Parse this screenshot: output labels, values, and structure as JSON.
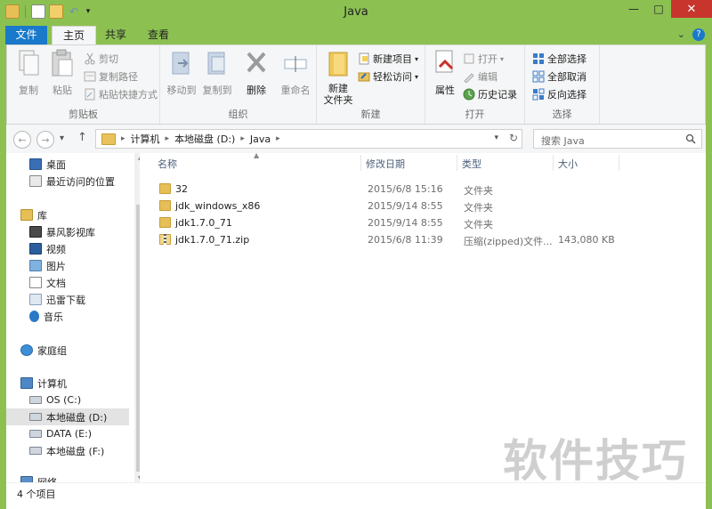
{
  "window": {
    "title": "Java",
    "controls": {
      "minimize": "—",
      "maximize": "□",
      "close": "✕"
    }
  },
  "quick_access": {
    "icons": [
      "folder-icon",
      "properties-icon",
      "new-folder-icon",
      "undo-icon",
      "dropdown-icon"
    ]
  },
  "ribbon_tabs": [
    "文件",
    "主页",
    "共享",
    "查看"
  ],
  "ribbon": {
    "clipboard": {
      "label": "剪贴板",
      "copy": "复制",
      "paste": "粘贴",
      "cut": "剪切",
      "copy_path": "复制路径",
      "paste_shortcut": "粘贴快捷方式"
    },
    "organize": {
      "label": "组织",
      "move_to": "移动到",
      "copy_to": "复制到",
      "delete": "删除",
      "rename": "重命名"
    },
    "new": {
      "label": "新建",
      "new_folder": "新建\n文件夹",
      "new_item": "新建项目",
      "easy_access": "轻松访问"
    },
    "open": {
      "label": "打开",
      "properties": "属性",
      "open": "打开",
      "edit": "编辑",
      "history": "历史记录"
    },
    "select": {
      "label": "选择",
      "select_all": "全部选择",
      "select_none": "全部取消",
      "invert": "反向选择"
    }
  },
  "address_bar": {
    "crumbs": [
      "计算机",
      "本地磁盘 (D:)",
      "Java"
    ],
    "search_placeholder": "搜索 Java"
  },
  "nav_pane": {
    "items": [
      {
        "label": "桌面",
        "icon": "desktop-icon"
      },
      {
        "label": "最近访问的位置",
        "icon": "recent-places-icon"
      },
      {
        "label": "库",
        "icon": "library-icon"
      },
      {
        "label": "暴风影视库",
        "icon": "video-library-icon"
      },
      {
        "label": "视频",
        "icon": "videos-icon"
      },
      {
        "label": "图片",
        "icon": "pictures-icon"
      },
      {
        "label": "文档",
        "icon": "documents-icon"
      },
      {
        "label": "迅雷下载",
        "icon": "downloads-icon"
      },
      {
        "label": "音乐",
        "icon": "music-icon"
      },
      {
        "label": "家庭组",
        "icon": "homegroup-icon"
      },
      {
        "label": "计算机",
        "icon": "computer-icon"
      },
      {
        "label": "OS (C:)",
        "icon": "drive-icon"
      },
      {
        "label": "本地磁盘 (D:)",
        "icon": "drive-icon"
      },
      {
        "label": "DATA (E:)",
        "icon": "drive-icon"
      },
      {
        "label": "本地磁盘 (F:)",
        "icon": "drive-icon"
      },
      {
        "label": "网络",
        "icon": "network-icon"
      }
    ]
  },
  "file_list": {
    "columns": [
      "名称",
      "修改日期",
      "类型",
      "大小"
    ],
    "rows": [
      {
        "name": "32",
        "date": "2015/6/8 15:16",
        "type": "文件夹",
        "size": ""
      },
      {
        "name": "jdk_windows_x86",
        "date": "2015/9/14 8:55",
        "type": "文件夹",
        "size": ""
      },
      {
        "name": "jdk1.7.0_71",
        "date": "2015/9/14 8:55",
        "type": "文件夹",
        "size": ""
      },
      {
        "name": "jdk1.7.0_71.zip",
        "date": "2015/6/8 11:39",
        "type": "压缩(zipped)文件...",
        "size": "143,080 KB"
      }
    ]
  },
  "status": {
    "item_count": "4 个项目"
  },
  "watermark": "软件技巧",
  "colors": {
    "frame": "#8cc152",
    "file_tab": "#1979ca",
    "close_button": "#c7352d",
    "folder": "#e6bf57"
  }
}
